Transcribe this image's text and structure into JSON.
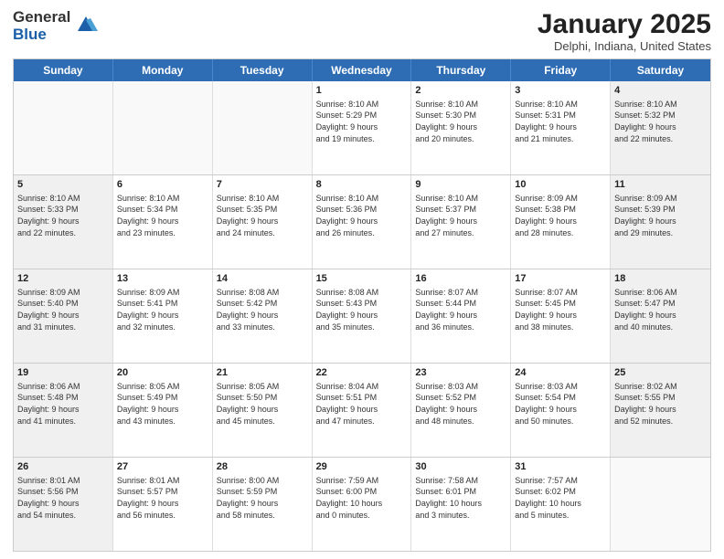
{
  "logo": {
    "general": "General",
    "blue": "Blue"
  },
  "header": {
    "title": "January 2025",
    "subtitle": "Delphi, Indiana, United States"
  },
  "weekdays": [
    "Sunday",
    "Monday",
    "Tuesday",
    "Wednesday",
    "Thursday",
    "Friday",
    "Saturday"
  ],
  "weeks": [
    [
      {
        "day": "",
        "info": "",
        "empty": true
      },
      {
        "day": "",
        "info": "",
        "empty": true
      },
      {
        "day": "",
        "info": "",
        "empty": true
      },
      {
        "day": "1",
        "info": "Sunrise: 8:10 AM\nSunset: 5:29 PM\nDaylight: 9 hours\nand 19 minutes."
      },
      {
        "day": "2",
        "info": "Sunrise: 8:10 AM\nSunset: 5:30 PM\nDaylight: 9 hours\nand 20 minutes."
      },
      {
        "day": "3",
        "info": "Sunrise: 8:10 AM\nSunset: 5:31 PM\nDaylight: 9 hours\nand 21 minutes."
      },
      {
        "day": "4",
        "info": "Sunrise: 8:10 AM\nSunset: 5:32 PM\nDaylight: 9 hours\nand 22 minutes."
      }
    ],
    [
      {
        "day": "5",
        "info": "Sunrise: 8:10 AM\nSunset: 5:33 PM\nDaylight: 9 hours\nand 22 minutes."
      },
      {
        "day": "6",
        "info": "Sunrise: 8:10 AM\nSunset: 5:34 PM\nDaylight: 9 hours\nand 23 minutes."
      },
      {
        "day": "7",
        "info": "Sunrise: 8:10 AM\nSunset: 5:35 PM\nDaylight: 9 hours\nand 24 minutes."
      },
      {
        "day": "8",
        "info": "Sunrise: 8:10 AM\nSunset: 5:36 PM\nDaylight: 9 hours\nand 26 minutes."
      },
      {
        "day": "9",
        "info": "Sunrise: 8:10 AM\nSunset: 5:37 PM\nDaylight: 9 hours\nand 27 minutes."
      },
      {
        "day": "10",
        "info": "Sunrise: 8:09 AM\nSunset: 5:38 PM\nDaylight: 9 hours\nand 28 minutes."
      },
      {
        "day": "11",
        "info": "Sunrise: 8:09 AM\nSunset: 5:39 PM\nDaylight: 9 hours\nand 29 minutes."
      }
    ],
    [
      {
        "day": "12",
        "info": "Sunrise: 8:09 AM\nSunset: 5:40 PM\nDaylight: 9 hours\nand 31 minutes."
      },
      {
        "day": "13",
        "info": "Sunrise: 8:09 AM\nSunset: 5:41 PM\nDaylight: 9 hours\nand 32 minutes."
      },
      {
        "day": "14",
        "info": "Sunrise: 8:08 AM\nSunset: 5:42 PM\nDaylight: 9 hours\nand 33 minutes."
      },
      {
        "day": "15",
        "info": "Sunrise: 8:08 AM\nSunset: 5:43 PM\nDaylight: 9 hours\nand 35 minutes."
      },
      {
        "day": "16",
        "info": "Sunrise: 8:07 AM\nSunset: 5:44 PM\nDaylight: 9 hours\nand 36 minutes."
      },
      {
        "day": "17",
        "info": "Sunrise: 8:07 AM\nSunset: 5:45 PM\nDaylight: 9 hours\nand 38 minutes."
      },
      {
        "day": "18",
        "info": "Sunrise: 8:06 AM\nSunset: 5:47 PM\nDaylight: 9 hours\nand 40 minutes."
      }
    ],
    [
      {
        "day": "19",
        "info": "Sunrise: 8:06 AM\nSunset: 5:48 PM\nDaylight: 9 hours\nand 41 minutes."
      },
      {
        "day": "20",
        "info": "Sunrise: 8:05 AM\nSunset: 5:49 PM\nDaylight: 9 hours\nand 43 minutes."
      },
      {
        "day": "21",
        "info": "Sunrise: 8:05 AM\nSunset: 5:50 PM\nDaylight: 9 hours\nand 45 minutes."
      },
      {
        "day": "22",
        "info": "Sunrise: 8:04 AM\nSunset: 5:51 PM\nDaylight: 9 hours\nand 47 minutes."
      },
      {
        "day": "23",
        "info": "Sunrise: 8:03 AM\nSunset: 5:52 PM\nDaylight: 9 hours\nand 48 minutes."
      },
      {
        "day": "24",
        "info": "Sunrise: 8:03 AM\nSunset: 5:54 PM\nDaylight: 9 hours\nand 50 minutes."
      },
      {
        "day": "25",
        "info": "Sunrise: 8:02 AM\nSunset: 5:55 PM\nDaylight: 9 hours\nand 52 minutes."
      }
    ],
    [
      {
        "day": "26",
        "info": "Sunrise: 8:01 AM\nSunset: 5:56 PM\nDaylight: 9 hours\nand 54 minutes."
      },
      {
        "day": "27",
        "info": "Sunrise: 8:01 AM\nSunset: 5:57 PM\nDaylight: 9 hours\nand 56 minutes."
      },
      {
        "day": "28",
        "info": "Sunrise: 8:00 AM\nSunset: 5:59 PM\nDaylight: 9 hours\nand 58 minutes."
      },
      {
        "day": "29",
        "info": "Sunrise: 7:59 AM\nSunset: 6:00 PM\nDaylight: 10 hours\nand 0 minutes."
      },
      {
        "day": "30",
        "info": "Sunrise: 7:58 AM\nSunset: 6:01 PM\nDaylight: 10 hours\nand 3 minutes."
      },
      {
        "day": "31",
        "info": "Sunrise: 7:57 AM\nSunset: 6:02 PM\nDaylight: 10 hours\nand 5 minutes."
      },
      {
        "day": "",
        "info": "",
        "empty": true
      }
    ]
  ]
}
